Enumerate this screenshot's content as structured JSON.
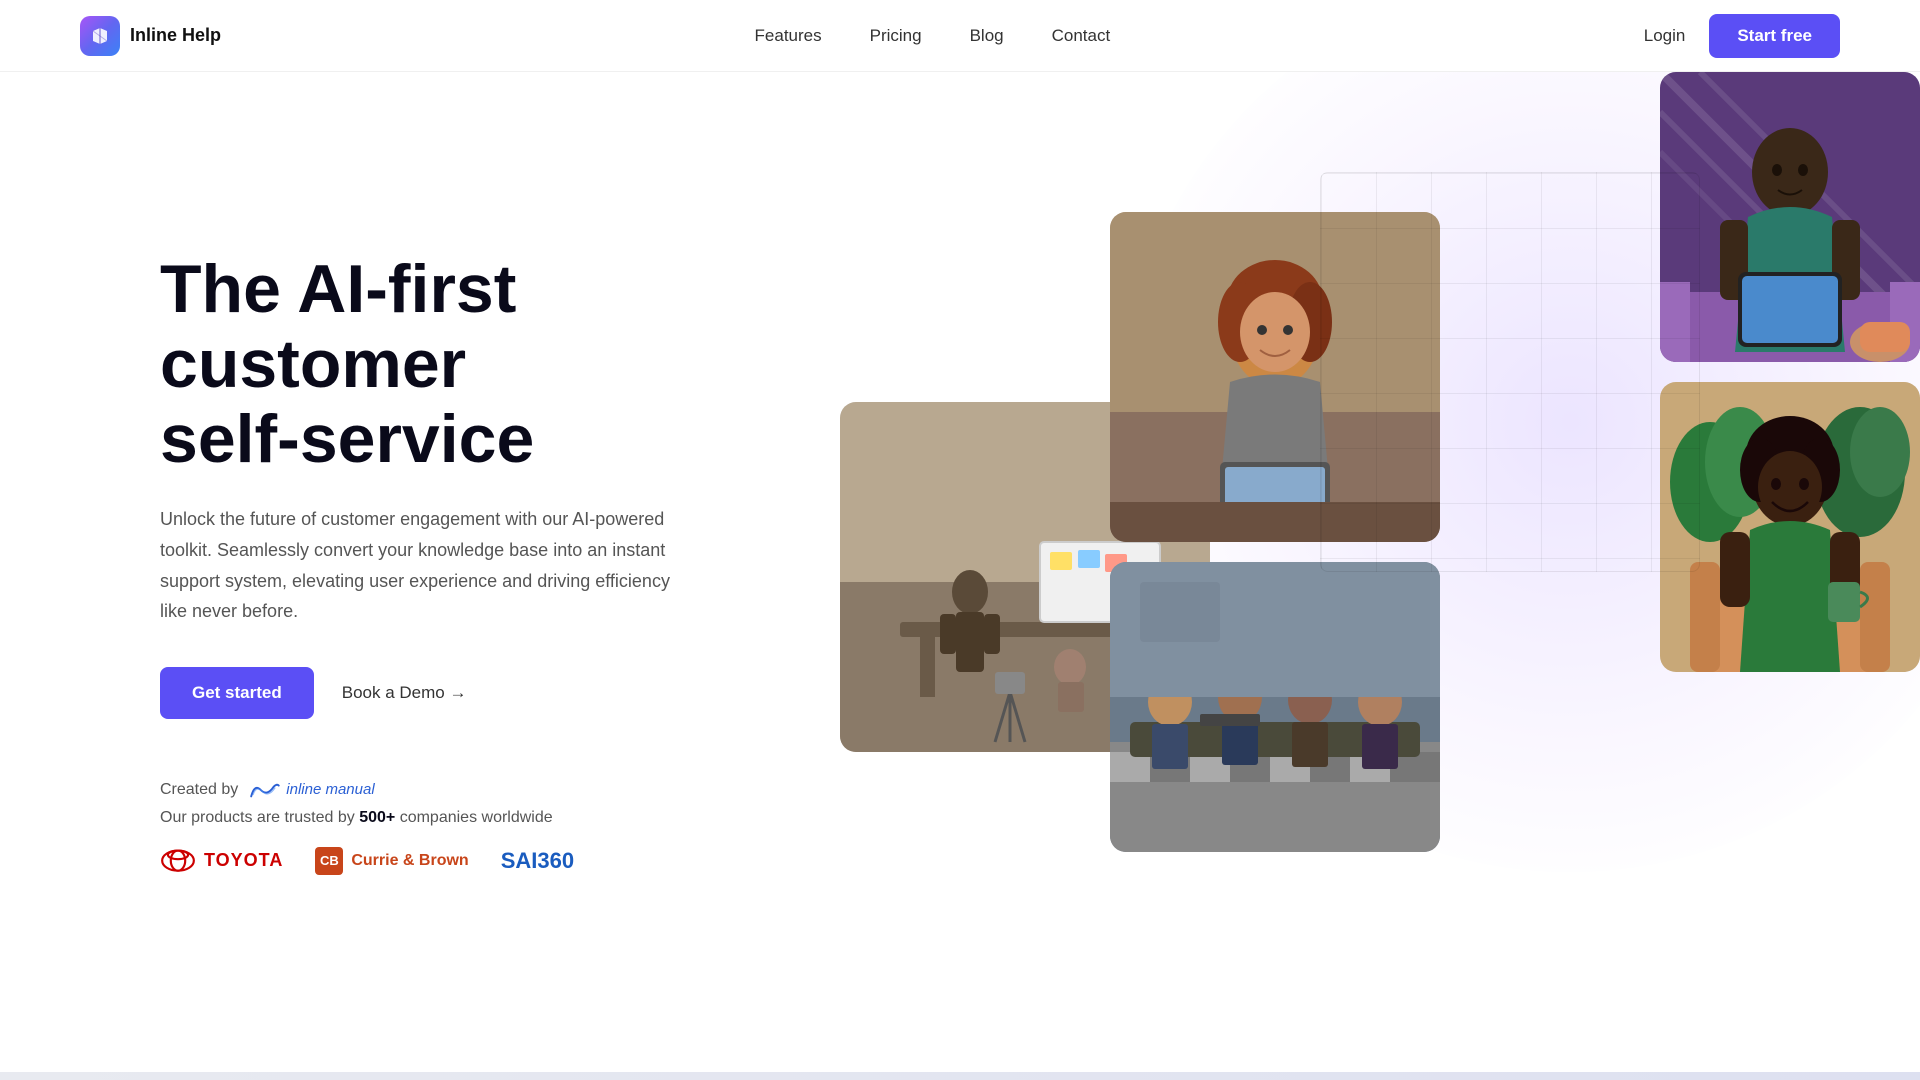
{
  "nav": {
    "logo_text": "Inline Help",
    "links": [
      {
        "label": "Features",
        "id": "features"
      },
      {
        "label": "Pricing",
        "id": "pricing"
      },
      {
        "label": "Blog",
        "id": "blog"
      },
      {
        "label": "Contact",
        "id": "contact"
      }
    ],
    "login_label": "Login",
    "start_free_label": "Start free"
  },
  "hero": {
    "title_line1": "The AI-first customer",
    "title_line2": "self-service",
    "description": "Unlock the future of customer engagement with our AI-powered toolkit. Seamlessly convert your knowledge base into an instant support system, elevating user experience and driving efficiency like never before.",
    "btn_get_started": "Get started",
    "btn_book_demo": "Book a Demo →",
    "created_by_label": "Created by",
    "inline_manual_text": "inline manual",
    "trusted_prefix": "Our products are trusted by ",
    "trusted_count": "500+",
    "trusted_suffix": " companies worldwide",
    "brands": [
      {
        "name": "TOYOTA",
        "type": "toyota"
      },
      {
        "name": "Currie & Brown",
        "type": "cb"
      },
      {
        "name": "SAI360",
        "type": "sai360"
      }
    ]
  },
  "colors": {
    "accent": "#5b4ff5",
    "text_primary": "#0a0a1a",
    "text_secondary": "#555555"
  }
}
